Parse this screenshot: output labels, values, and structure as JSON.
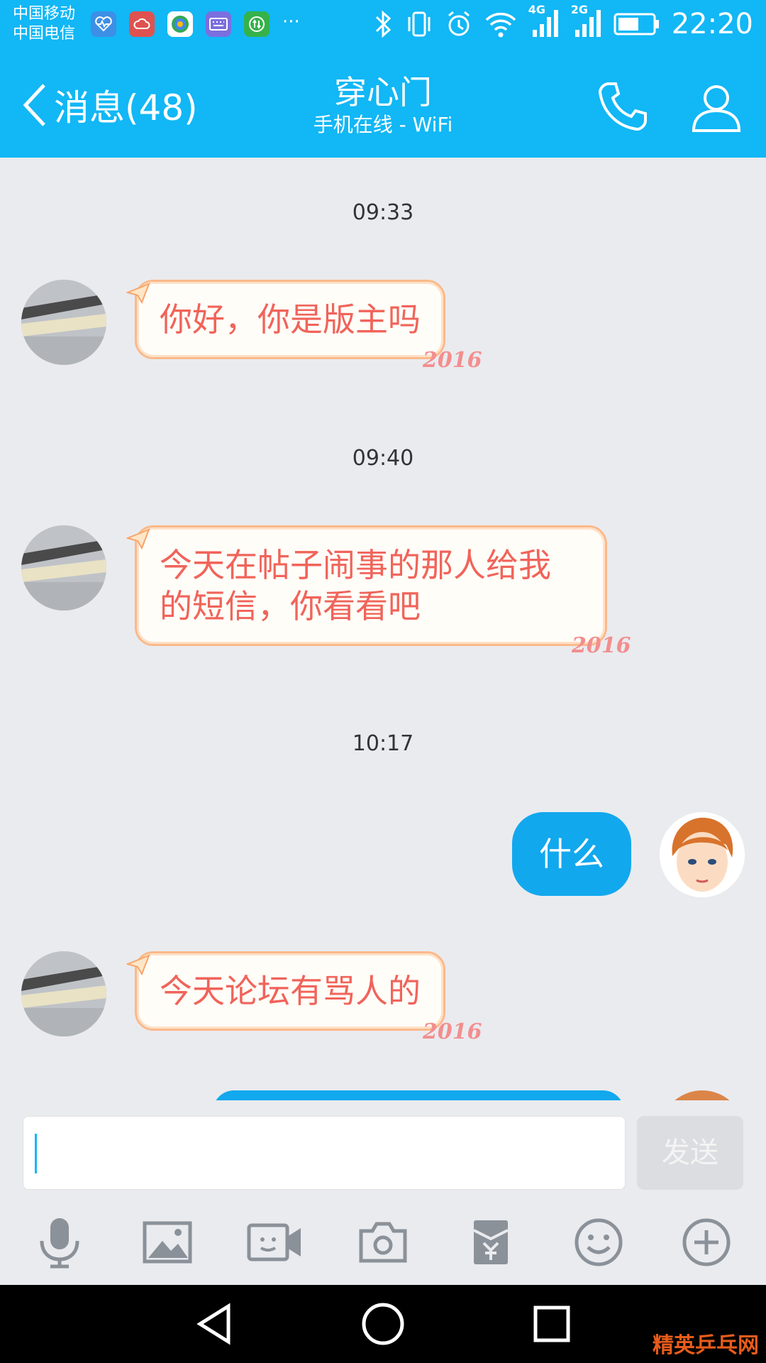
{
  "status_bar": {
    "carrier_1": "中国移动",
    "carrier_2": "中国电信",
    "net_1": "4G",
    "net_2": "2G",
    "time": "22:20",
    "more": "···"
  },
  "header": {
    "back_label": "消息(48)",
    "title": "穿心门",
    "subtitle": "手机在线 - WiFi"
  },
  "messages": [
    {
      "time": "09:33",
      "direction": "in",
      "text": "你好，你是版主吗"
    },
    {
      "time": "09:40",
      "direction": "in",
      "text": "今天在帖子闹事的那人给我的短信，你看看吧"
    },
    {
      "time": "10:17",
      "direction": "out",
      "text": "什么"
    },
    {
      "time": "",
      "direction": "in",
      "text": "今天论坛有骂人的"
    }
  ],
  "bubble_stamp": "2016",
  "input": {
    "value": "",
    "send_label": "发送"
  },
  "watermark": "精英乒乓网",
  "colors": {
    "accent": "#12b7f5",
    "out_bubble": "#12a8ee",
    "in_bubble_text": "#f0645a",
    "in_bubble_border": "#fbb98a"
  }
}
